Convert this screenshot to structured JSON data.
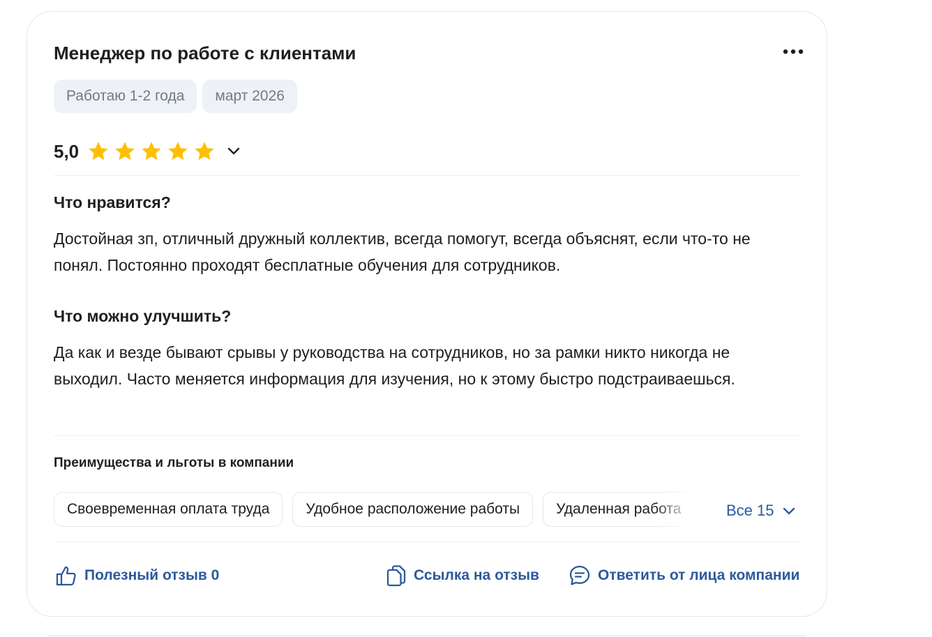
{
  "review": {
    "title": "Менеджер по работе с клиентами",
    "tags": [
      "Работаю 1-2 года",
      "март 2026"
    ],
    "rating": {
      "value_label": "5,0",
      "value": 5,
      "max": 5,
      "star_color": "#ffbf00"
    },
    "likes_title": "Что нравится?",
    "likes_text": "Достойная зп, отличный дружный коллектив, всегда помогут, всегда объяснят, если что-то не понял. Постоянно проходят бесплатные обучения для сотрудников.",
    "improve_title": "Что можно улучшить?",
    "improve_text": "Да как и везде бывают срывы у руководства на сотрудников, но за рамки никто никогда не выходил. Часто меняется информация для изучения, но к этому быстро подстраиваешься.",
    "benefits": {
      "title": "Преимущества и льготы в компании",
      "items": [
        "Своевременная оплата труда",
        "Удобное расположение работы",
        "Удаленная работа"
      ],
      "all_label": "Все 15"
    },
    "actions": {
      "helpful_label": "Полезный отзыв 0",
      "link_label": "Ссылка на отзыв",
      "reply_label": "Ответить от лица компании"
    }
  },
  "colors": {
    "accent": "#2c5a9c",
    "tag_bg": "#eef1f6",
    "tag_text": "#707a87",
    "star": "#ffbf00"
  },
  "icons": [
    "more-horizontal-icon",
    "star-icon",
    "chevron-down-icon",
    "thumbs-up-icon",
    "copy-icon",
    "chat-icon"
  ]
}
